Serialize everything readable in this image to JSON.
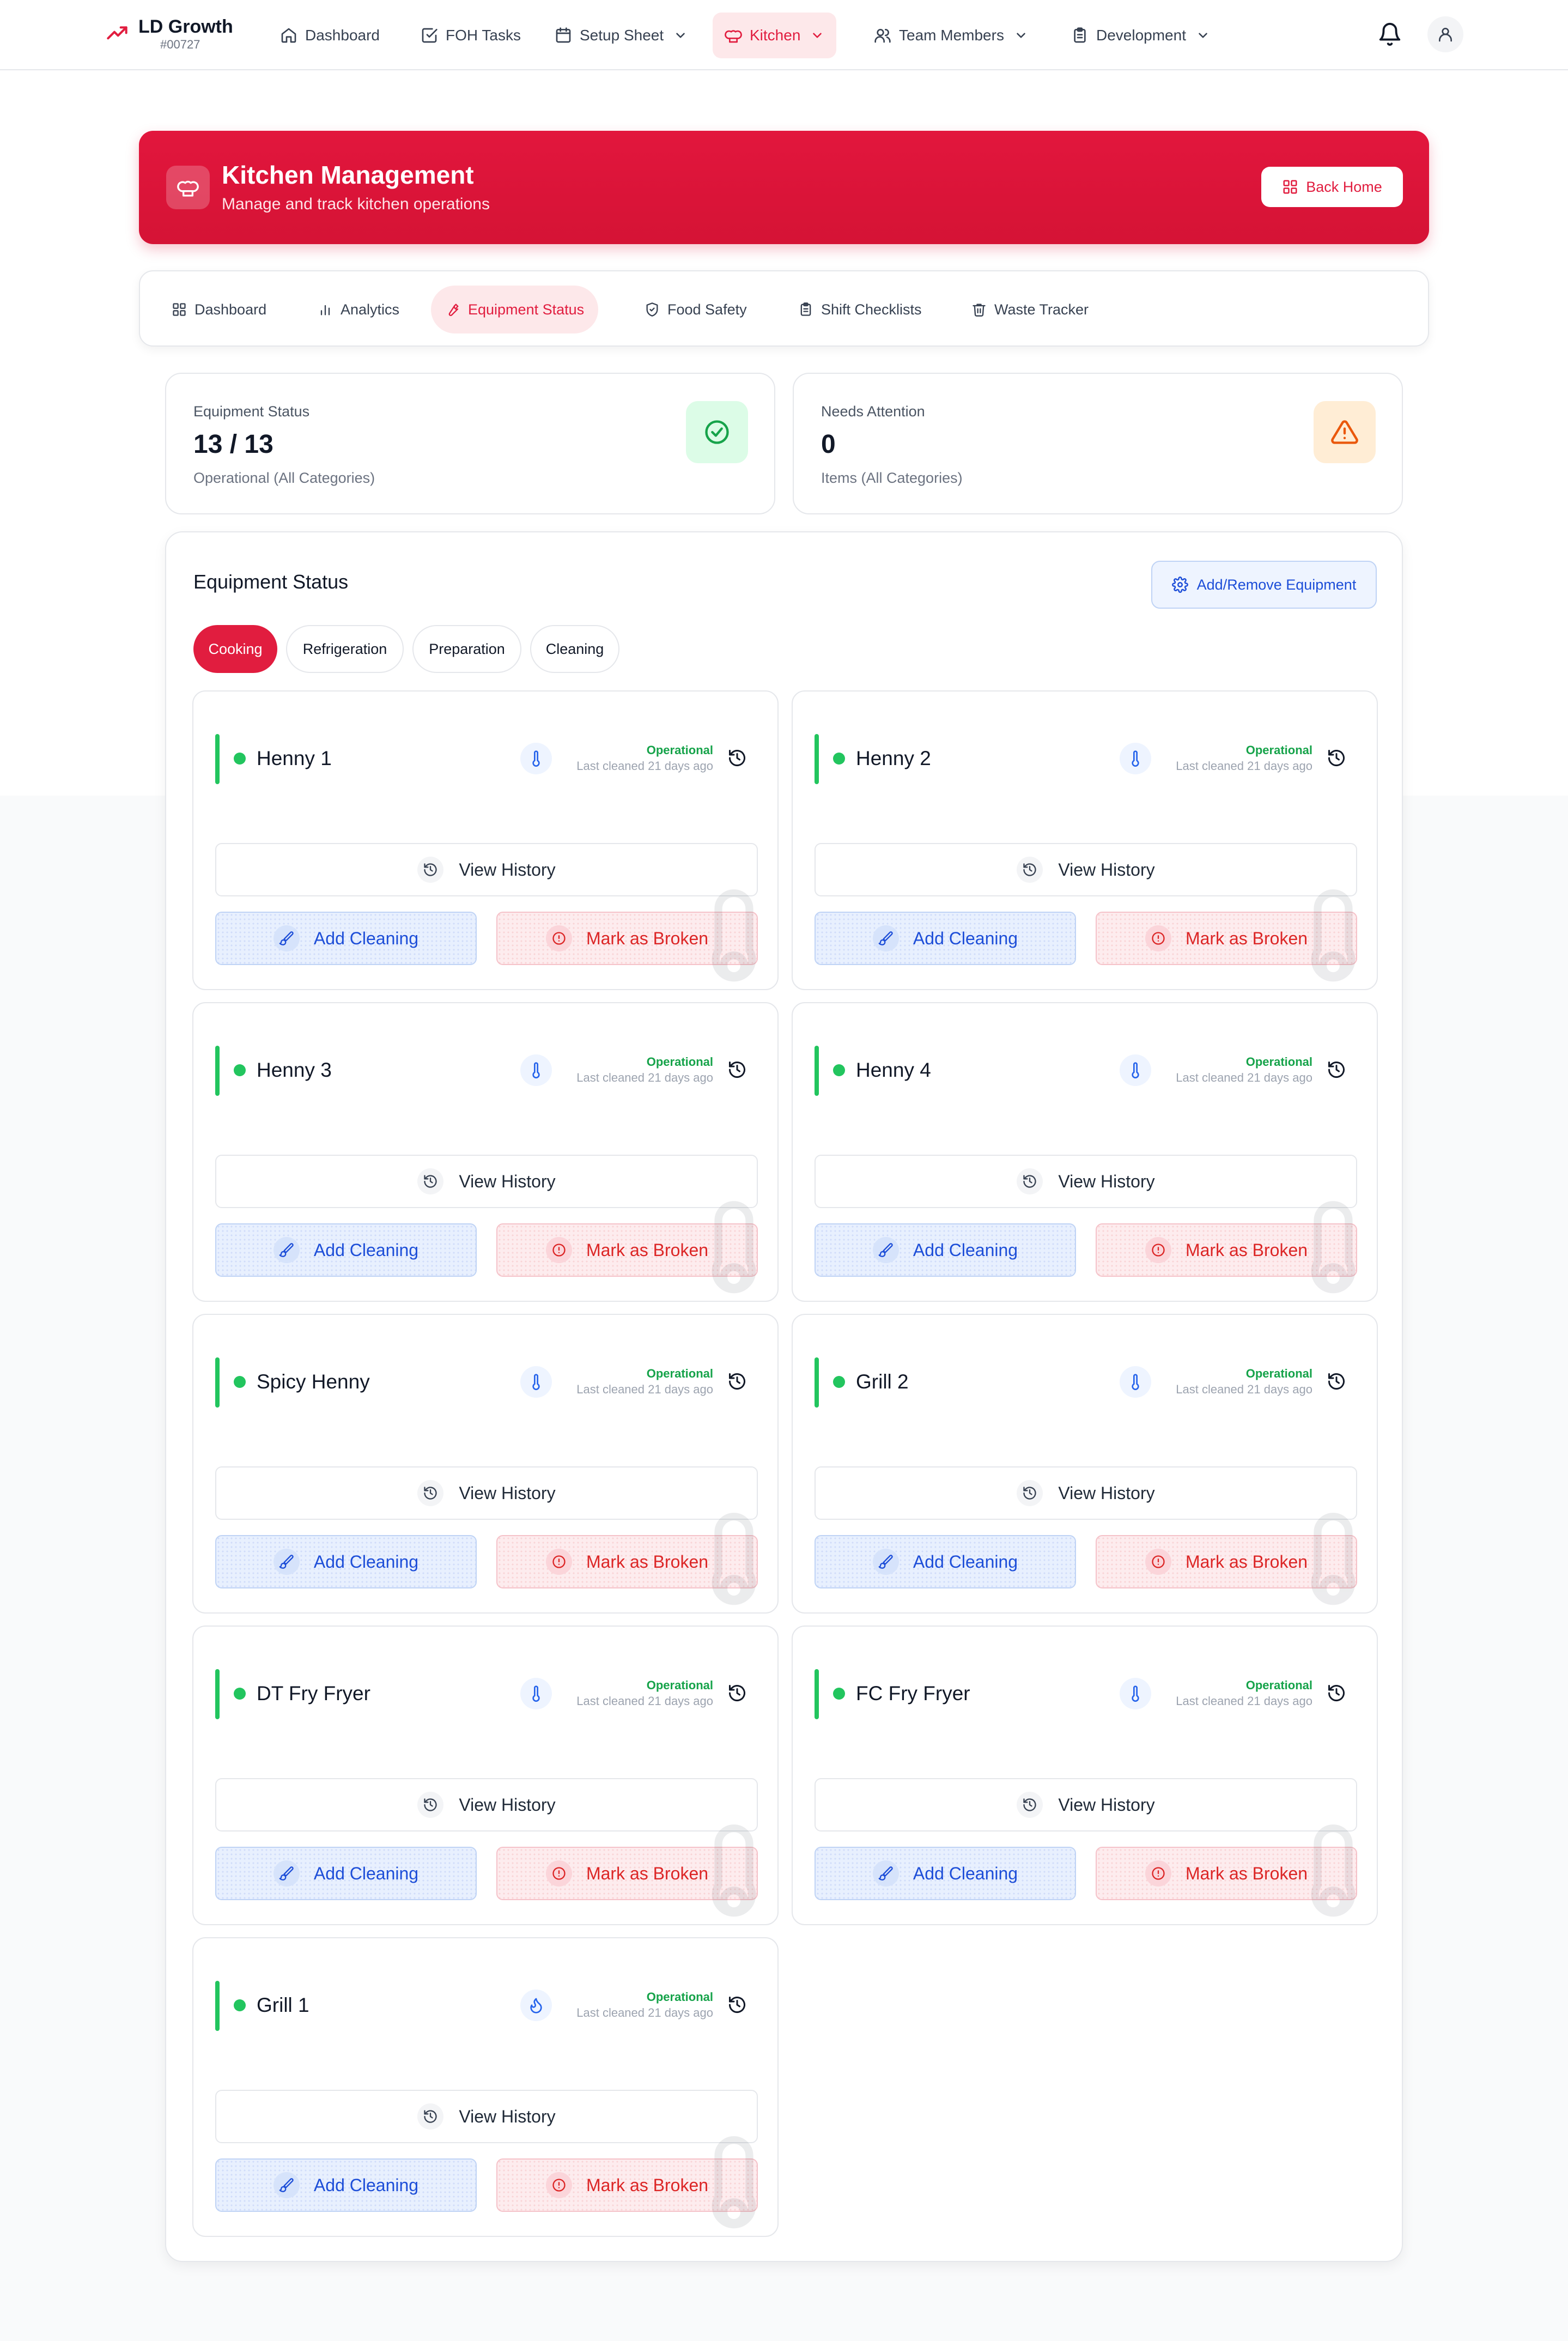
{
  "nav": {
    "brand_title": "LD Growth",
    "brand_sub": "#00727",
    "items": [
      {
        "label": "Dashboard",
        "icon": "home-icon"
      },
      {
        "label": "FOH Tasks",
        "icon": "checkbox-icon"
      },
      {
        "label": "Setup Sheet",
        "icon": "calendar-icon",
        "dropdown": true
      },
      {
        "label": "Kitchen",
        "icon": "chef-hat-icon",
        "dropdown": true,
        "active": true
      },
      {
        "label": "Team Members",
        "icon": "users-icon",
        "dropdown": true
      },
      {
        "label": "Development",
        "icon": "clipboard-icon",
        "dropdown": true
      }
    ]
  },
  "header": {
    "title": "Kitchen Management",
    "subtitle": "Manage and track kitchen operations",
    "back_label": "Back Home"
  },
  "tabs": [
    {
      "label": "Dashboard",
      "icon": "grid-icon"
    },
    {
      "label": "Analytics",
      "icon": "bar-chart-icon"
    },
    {
      "label": "Equipment Status",
      "icon": "wrench-icon",
      "active": true
    },
    {
      "label": "Food Safety",
      "icon": "shield-icon"
    },
    {
      "label": "Shift Checklists",
      "icon": "clipboard-icon"
    },
    {
      "label": "Waste Tracker",
      "icon": "trash-icon"
    }
  ],
  "stats": {
    "equipment": {
      "label": "Equipment Status",
      "value": "13 / 13",
      "sub": "Operational (All Categories)"
    },
    "attention": {
      "label": "Needs Attention",
      "value": "0",
      "sub": "Items (All Categories)"
    }
  },
  "panel": {
    "title": "Equipment Status",
    "manage_label": "Add/Remove Equipment",
    "categories": [
      "Cooking",
      "Refrigeration",
      "Preparation",
      "Cleaning"
    ],
    "active_category": "Cooking"
  },
  "card_labels": {
    "view_history": "View History",
    "add_cleaning": "Add Cleaning",
    "mark_broken": "Mark as Broken"
  },
  "equipment": [
    {
      "name": "Henny 1",
      "status": "Operational",
      "cleaned": "Last cleaned 21 days ago",
      "type_icon": "thermometer-icon"
    },
    {
      "name": "Henny 2",
      "status": "Operational",
      "cleaned": "Last cleaned 21 days ago",
      "type_icon": "thermometer-icon"
    },
    {
      "name": "Henny 3",
      "status": "Operational",
      "cleaned": "Last cleaned 21 days ago",
      "type_icon": "thermometer-icon"
    },
    {
      "name": "Henny 4",
      "status": "Operational",
      "cleaned": "Last cleaned 21 days ago",
      "type_icon": "thermometer-icon"
    },
    {
      "name": "Spicy Henny",
      "status": "Operational",
      "cleaned": "Last cleaned 21 days ago",
      "type_icon": "thermometer-icon"
    },
    {
      "name": "Grill 2",
      "status": "Operational",
      "cleaned": "Last cleaned 21 days ago",
      "type_icon": "thermometer-icon"
    },
    {
      "name": "DT Fry Fryer",
      "status": "Operational",
      "cleaned": "Last cleaned 21 days ago",
      "type_icon": "thermometer-icon"
    },
    {
      "name": "FC Fry Fryer",
      "status": "Operational",
      "cleaned": "Last cleaned 21 days ago",
      "type_icon": "thermometer-icon"
    },
    {
      "name": "Grill 1",
      "status": "Operational",
      "cleaned": "Last cleaned 21 days ago",
      "type_icon": "flame-icon"
    }
  ],
  "colors": {
    "brand_red": "#e11d3f",
    "operational_green": "#22c55e",
    "action_blue": "#1d4ed8",
    "danger_red": "#dc2626"
  }
}
